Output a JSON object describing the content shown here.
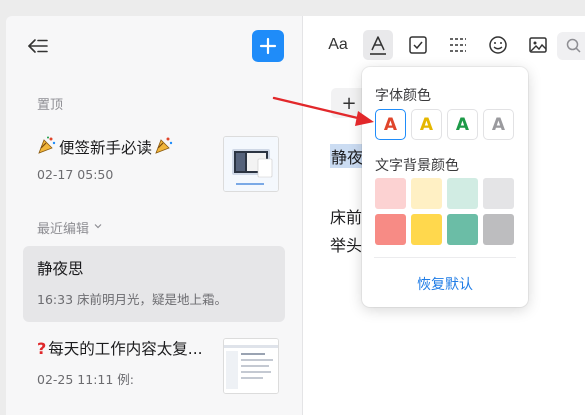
{
  "sidebar": {
    "section_pinned": "置顶",
    "section_recent": "最近编辑",
    "notes": [
      {
        "title": "便签新手必读",
        "subtitle": "02-17 05:50",
        "icon": "party-popper",
        "has_thumb": true
      },
      {
        "title": "静夜思",
        "subtitle": "16:33 床前明月光，疑是地上霜。",
        "selected": true,
        "has_thumb": false
      },
      {
        "title": "每天的工作内容太复...",
        "subtitle": "02-25 11:11 例:",
        "icon": "question-mark",
        "has_thumb": true
      }
    ]
  },
  "toolbar": {
    "font_size_label": "Aa",
    "icons": [
      "font-size-icon",
      "font-color-icon",
      "checkbox-icon",
      "divider-icon",
      "emoji-icon",
      "image-icon",
      "search-icon"
    ]
  },
  "editor": {
    "insert_label": "+",
    "title_visible": "静夜",
    "line1_visible": "床前",
    "line2_visible": "举头"
  },
  "color_popover": {
    "font_color_label": "字体颜色",
    "bg_color_label": "文字背景颜色",
    "reset_label": "恢复默认",
    "font_colors": [
      {
        "glyph": "A",
        "color": "#e0452b",
        "selected": true
      },
      {
        "glyph": "A",
        "color": "#e5b700",
        "selected": false
      },
      {
        "glyph": "A",
        "color": "#1d9a48",
        "selected": false
      },
      {
        "glyph": "A",
        "color": "#9a9a9e",
        "selected": false
      }
    ],
    "bg_colors": [
      "#fcd2d2",
      "#fff0c4",
      "#d1ece3",
      "#e4e4e6",
      "#f78b85",
      "#ffd84d",
      "#6bbda6",
      "#bdbdbf"
    ]
  },
  "accent_color": "#1f8cf9",
  "annotation_color": "#e2282b"
}
